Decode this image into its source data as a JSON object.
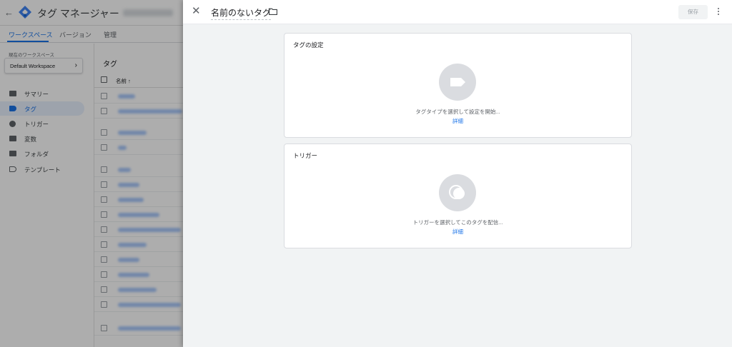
{
  "app": {
    "title": "タグ マネージャー",
    "tabs": [
      {
        "label": "ワークスペース"
      },
      {
        "label": "バージョン"
      },
      {
        "label": "管理"
      }
    ]
  },
  "sidebar": {
    "workspace_label": "現在のワークスペース",
    "workspace_name": "Default Workspace",
    "items": [
      {
        "label": "サマリー",
        "icon": "briefcase-icon"
      },
      {
        "label": "タグ",
        "icon": "tag-icon"
      },
      {
        "label": "トリガー",
        "icon": "trigger-icon"
      },
      {
        "label": "変数",
        "icon": "variables-icon"
      },
      {
        "label": "フォルダ",
        "icon": "folder-icon"
      },
      {
        "label": "テンプレート",
        "icon": "template-icon"
      }
    ]
  },
  "content": {
    "title": "タグ",
    "column_name": "名前 ↑"
  },
  "panel": {
    "tag_name": "名前のないタグ",
    "save_label": "保存",
    "tag_config": {
      "title": "タグの設定",
      "description": "タグタイプを選択して設定を開始...",
      "link": "詳細"
    },
    "triggering": {
      "title": "トリガー",
      "description": "トリガーを選択してこのタグを配信...",
      "link": "詳細"
    }
  },
  "colors": {
    "accent": "#1a73e8",
    "panel_bg": "#f1f3f4",
    "placeholder_circle": "#dadce0"
  }
}
